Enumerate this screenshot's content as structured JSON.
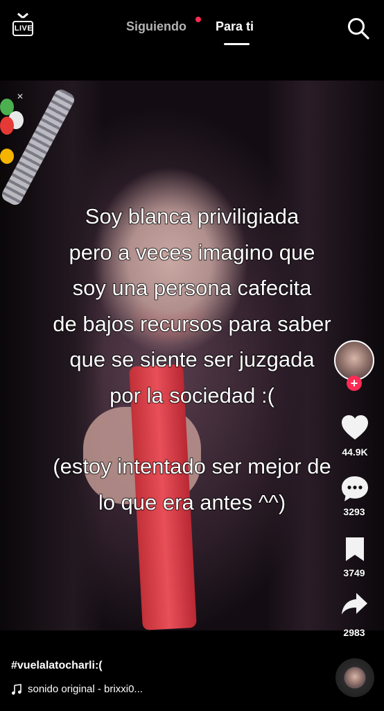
{
  "header": {
    "live_label": "LIVE",
    "tabs": [
      {
        "label": "Siguiendo",
        "active": false,
        "has_notification_dot": true
      },
      {
        "label": "Para ti",
        "active": true
      }
    ],
    "icons": {
      "live": "live-tv-icon",
      "search": "search-icon"
    }
  },
  "video": {
    "overlay_lines": [
      "Soy blanca priviligiada",
      "pero a veces imagino que",
      "soy una persona cafecita",
      "de bajos recursos para saber",
      "que se siente ser juzgada",
      "por la sociedad :(",
      "",
      "(estoy intentado ser mejor de",
      "lo que era antes ^^)"
    ]
  },
  "side_actions": {
    "likes": "44.9K",
    "comments": "3293",
    "saves": "3749",
    "shares": "2983"
  },
  "post": {
    "caption": "#vuelalatocharli:(",
    "sound": "sonido original - brixxi0..."
  },
  "colors": {
    "accent": "#fe2c55",
    "inactive_tab": "#b3b3b3",
    "background": "#000000"
  }
}
